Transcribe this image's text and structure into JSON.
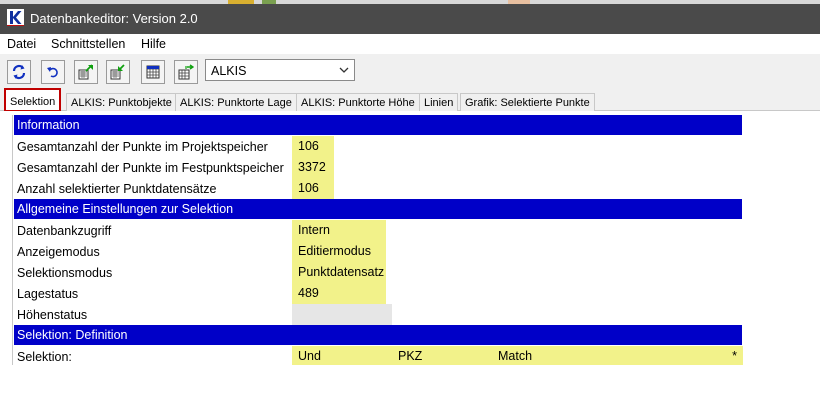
{
  "window": {
    "title": "Datenbankeditor: Version 2.0"
  },
  "menu": {
    "items": [
      "Datei",
      "Schnittstellen",
      "Hilfe"
    ]
  },
  "toolbar": {
    "combo_value": "ALKIS"
  },
  "tabs": [
    "Selektion",
    "ALKIS: Punktobjekte",
    "ALKIS: Punktorte Lage",
    "ALKIS: Punktorte Höhe",
    "Linien",
    "Grafik: Selektierte Punkte"
  ],
  "information": {
    "header": "Information",
    "rows": [
      {
        "label": "Gesamtanzahl der Punkte im Projektspeicher",
        "value": "106"
      },
      {
        "label": "Gesamtanzahl der Punkte im Festpunktspeicher",
        "value": "3372"
      },
      {
        "label": "Anzahl selektierter Punktdatensätze",
        "value": "106"
      }
    ]
  },
  "settings": {
    "header": "Allgemeine Einstellungen zur Selektion",
    "rows": [
      {
        "label": "Datenbankzugriff",
        "value": "Intern"
      },
      {
        "label": "Anzeigemodus",
        "value": "Editiermodus"
      },
      {
        "label": "Selektionsmodus",
        "value": "Punktdatensatz"
      },
      {
        "label": "Lagestatus",
        "value": "489"
      },
      {
        "label": "Höhenstatus",
        "value": ""
      }
    ]
  },
  "definition": {
    "header": "Selektion: Definition",
    "label": "Selektion:",
    "operator": "Und",
    "field": "PKZ",
    "mode": "Match",
    "pattern": "*"
  },
  "colors": {
    "section_header": "#0000c8",
    "value_highlight": "#f2f28a",
    "active_tab_border": "#c00000",
    "titlebar": "#4a4a4a"
  }
}
